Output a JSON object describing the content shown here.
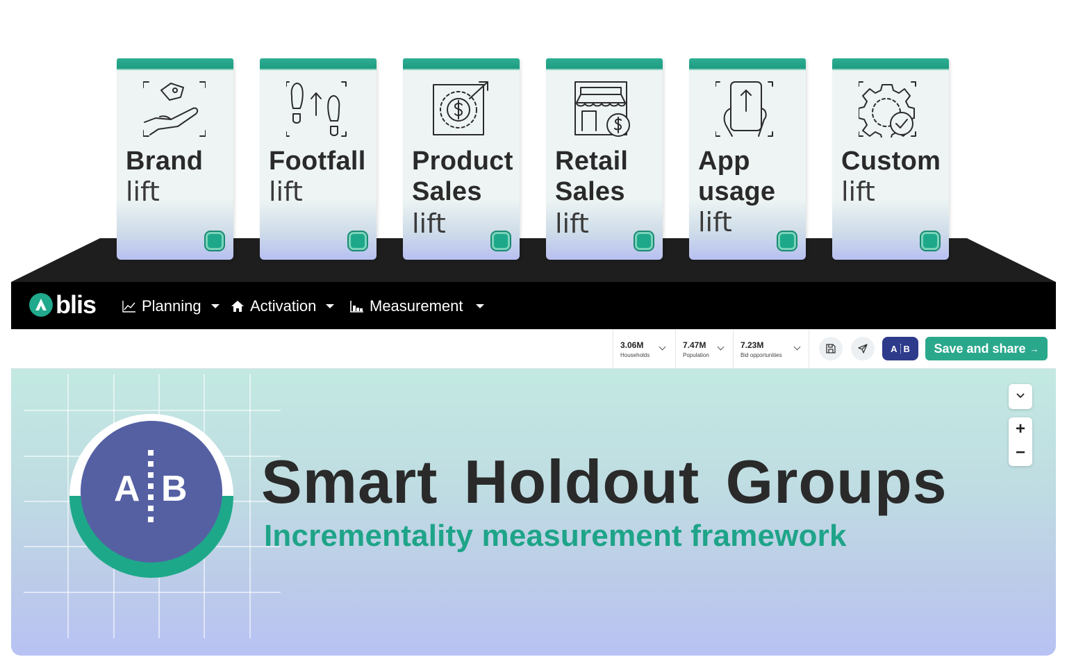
{
  "products": [
    {
      "title": [
        "Brand"
      ],
      "sub": "lift",
      "icon": "hand-tag-icon"
    },
    {
      "title": [
        "Footfall"
      ],
      "sub": "lift",
      "icon": "footsteps-icon"
    },
    {
      "title": [
        "Product",
        "Sales"
      ],
      "sub": "lift",
      "icon": "dollar-growth-icon"
    },
    {
      "title": [
        "Retail",
        "Sales"
      ],
      "sub": "lift",
      "icon": "storefront-icon"
    },
    {
      "title": [
        "App",
        "usage"
      ],
      "sub": "lift",
      "icon": "phone-tap-icon"
    },
    {
      "title": [
        "Custom"
      ],
      "sub": "lift",
      "icon": "gear-check-icon"
    }
  ],
  "nav": {
    "logo": "blis",
    "items": [
      {
        "label": "Planning",
        "icon": "line-chart-icon"
      },
      {
        "label": "Activation",
        "icon": "home-icon"
      },
      {
        "label": "Measurement",
        "icon": "bar-chart-icon"
      }
    ]
  },
  "toolbar": {
    "metrics": [
      {
        "value": "3.06M",
        "label": "Households"
      },
      {
        "value": "7.47M",
        "label": "Population"
      },
      {
        "value": "7.23M",
        "label": "Bid opportunities"
      }
    ],
    "ab_label_a": "A",
    "ab_label_b": "B",
    "save_label": "Save and share",
    "save_arrow": "→"
  },
  "hero": {
    "circle_a": "A",
    "circle_b": "B",
    "headline": "Smart Holdout Groups",
    "subline": "Incrementality measurement framework"
  },
  "map_controls": {
    "zoom_in": "+",
    "zoom_out": "−"
  },
  "colors": {
    "teal": "#2aa88c",
    "navy": "#2e3a8a",
    "circle": "#5560a3",
    "dark": "#1e1e1e"
  }
}
